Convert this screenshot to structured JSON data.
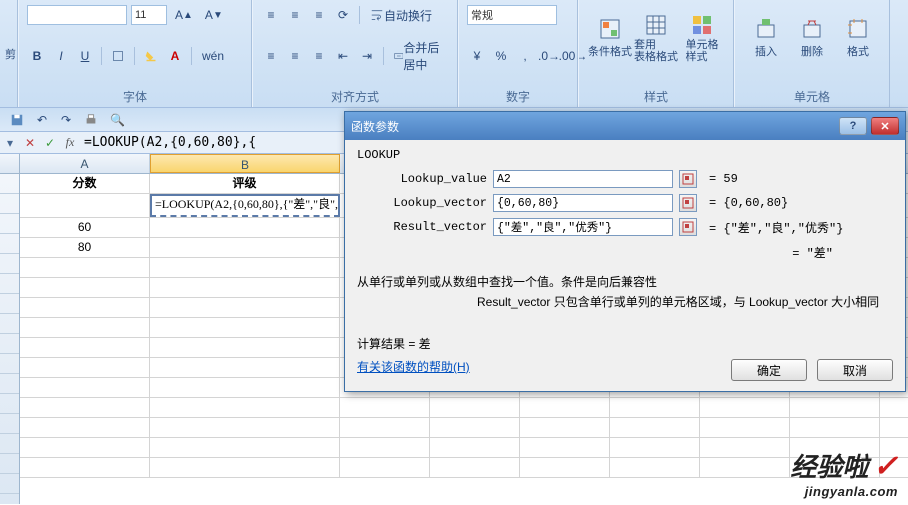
{
  "ribbon": {
    "cut_label": "剪",
    "font": {
      "size_value": "11",
      "bold": "B",
      "italic": "I",
      "underline": "U",
      "group_label": "字体"
    },
    "align": {
      "wrap": "自动换行",
      "merge": "合并后居中",
      "group_label": "对齐方式"
    },
    "number": {
      "format_value": "常规",
      "group_label": "数字"
    },
    "styles": {
      "cond": "条件格式",
      "table": "套用\n表格格式",
      "cell": "单元格\n样式",
      "group_label": "样式"
    },
    "cells": {
      "insert": "插入",
      "delete": "删除",
      "format": "格式",
      "group_label": "单元格"
    }
  },
  "formula_bar": {
    "value": "=LOOKUP(A2,{0,60,80},{"
  },
  "grid": {
    "col_A": "A",
    "col_B": "B",
    "headers": {
      "A": "分数",
      "B": "评级"
    },
    "rows": [
      {
        "A": "",
        "B": "=LOOKUP(A2,{0,60,80},{\"差\",\"良\","
      },
      {
        "A": "60",
        "B": ""
      },
      {
        "A": "80",
        "B": ""
      }
    ]
  },
  "dialog": {
    "title": "函数参数",
    "func_name": "LOOKUP",
    "args": [
      {
        "label": "Lookup_value",
        "value": "A2",
        "result": "= 59"
      },
      {
        "label": "Lookup_vector",
        "value": "{0,60,80}",
        "result": "= {0,60,80}"
      },
      {
        "label": "Result_vector",
        "value": "{\"差\",\"良\",\"优秀\"}",
        "result": "= {\"差\",\"良\",\"优秀\"}"
      }
    ],
    "eval_result": "= \"差\"",
    "desc1": "从单行或单列或从数组中查找一个值。条件是向后兼容性",
    "desc2": "Result_vector  只包含单行或单列的单元格区域，与 Lookup_vector 大小相同",
    "calc_result": "计算结果 = 差",
    "help_link": "有关该函数的帮助(H)",
    "ok": "确定",
    "cancel": "取消"
  },
  "watermark": {
    "text": "经验啦",
    "url": "jingyanla.com"
  }
}
